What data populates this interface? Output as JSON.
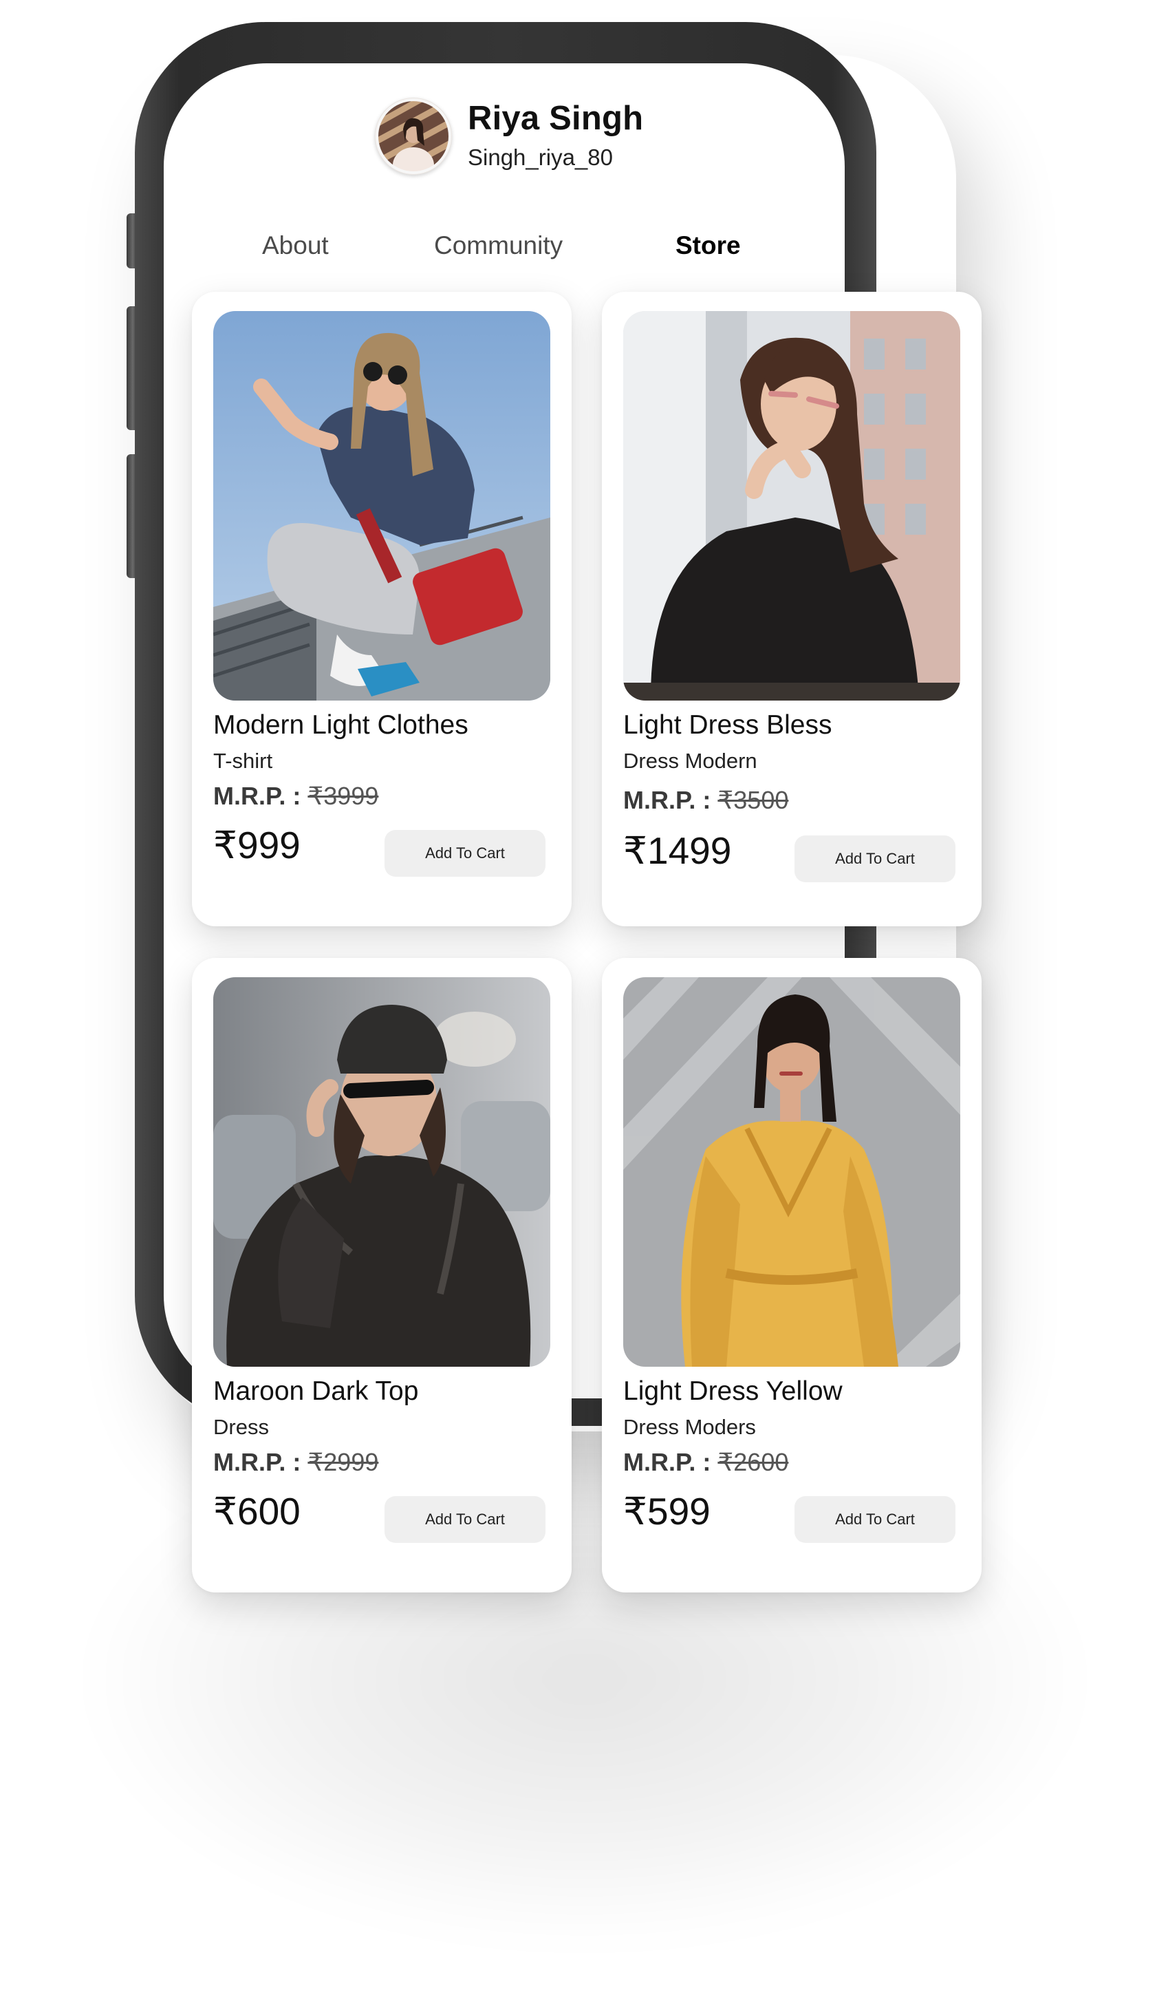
{
  "profile": {
    "name": "Riya Singh",
    "handle": "Singh_riya_80"
  },
  "tabs": [
    {
      "label": "About",
      "active": false
    },
    {
      "label": "Community",
      "active": false
    },
    {
      "label": "Store",
      "active": true
    }
  ],
  "products": [
    {
      "title": "Modern Light Clothes",
      "subtitle": "T-shirt",
      "mrp_label": "M.R.P. :",
      "mrp_value": "₹3999",
      "price": "₹999",
      "button_label": "Add To Cart",
      "image_icon": "woman-streetwear-red-bag-photo"
    },
    {
      "title": "Light Dress Bless",
      "subtitle": "Dress Modern",
      "mrp_label": "M.R.P. :",
      "mrp_value": "₹3500",
      "price": "₹1499",
      "button_label": "Add To Cart",
      "image_icon": "woman-black-top-sunglasses-photo"
    },
    {
      "title": "Maroon Dark Top",
      "subtitle": "Dress",
      "mrp_label": "M.R.P. :",
      "mrp_value": "₹2999",
      "price": "₹600",
      "button_label": "Add To Cart",
      "image_icon": "woman-leather-jacket-beanie-photo"
    },
    {
      "title": "Light Dress Yellow",
      "subtitle": "Dress Moders",
      "mrp_label": "M.R.P. :",
      "mrp_value": "₹2600",
      "price": "₹599",
      "button_label": "Add To Cart",
      "image_icon": "woman-yellow-dress-photo"
    }
  ],
  "colors": {
    "phone_frame": "#333333",
    "card_background": "#ffffff",
    "button_background": "#efefef",
    "text_primary": "#111111"
  }
}
